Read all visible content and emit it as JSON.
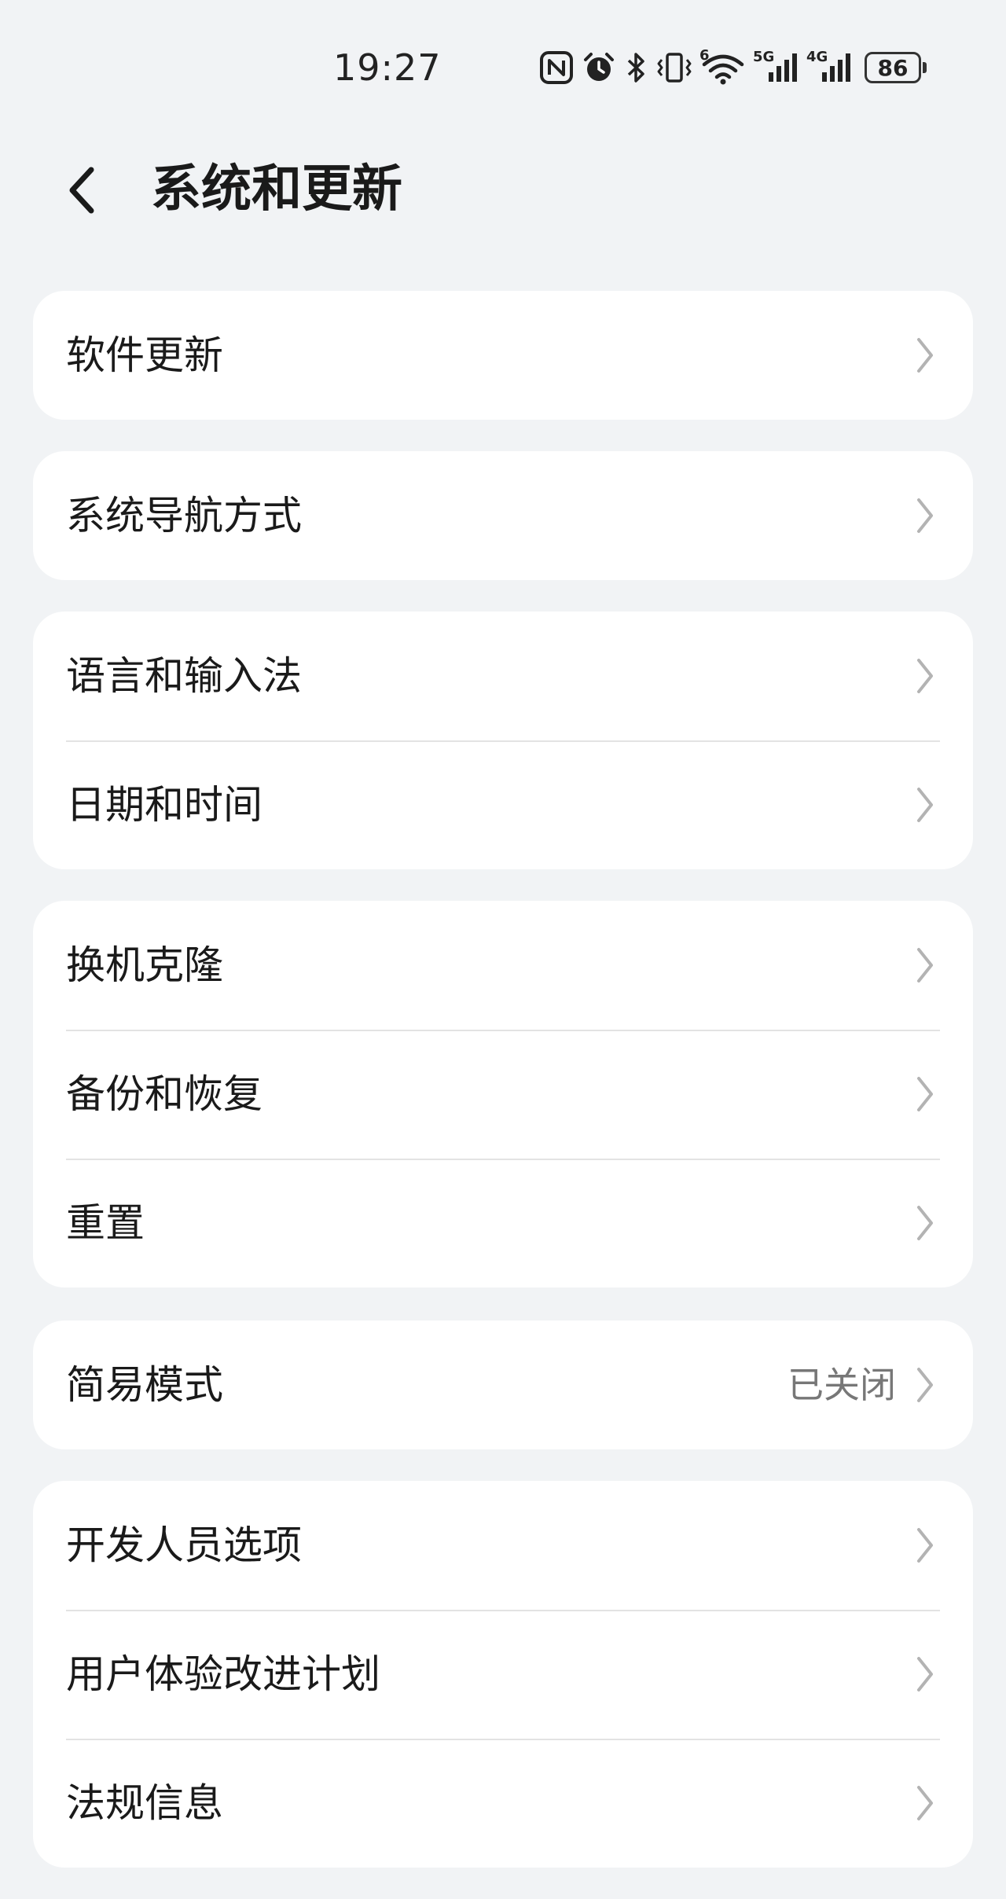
{
  "status_bar": {
    "time": "19:27",
    "battery_level": "86",
    "icons": [
      "nfc-icon",
      "alarm-icon",
      "bluetooth-icon",
      "vibrate-icon",
      "wifi-icon",
      "signal-5g-icon",
      "signal-4g-icon",
      "battery-icon"
    ],
    "network_labels": [
      "5G",
      "4G"
    ],
    "wifi_label": "6"
  },
  "header": {
    "title": "系统和更新",
    "back_icon": "chevron-left-icon"
  },
  "groups": [
    {
      "items": [
        {
          "label": "软件更新"
        }
      ]
    },
    {
      "items": [
        {
          "label": "系统导航方式"
        }
      ]
    },
    {
      "items": [
        {
          "label": "语言和输入法"
        },
        {
          "label": "日期和时间"
        }
      ]
    },
    {
      "items": [
        {
          "label": "换机克隆"
        },
        {
          "label": "备份和恢复"
        },
        {
          "label": "重置"
        }
      ]
    },
    {
      "items": [
        {
          "label": "简易模式",
          "value": "已关闭"
        }
      ]
    },
    {
      "items": [
        {
          "label": "开发人员选项"
        },
        {
          "label": "用户体验改进计划"
        },
        {
          "label": "法规信息"
        }
      ]
    }
  ],
  "colors": {
    "background": "#f1f3f5",
    "card": "#ffffff",
    "text": "#1a1a1a",
    "secondary_text": "#777777",
    "chevron": "#b3b3b3",
    "divider": "#e3e3e3"
  }
}
